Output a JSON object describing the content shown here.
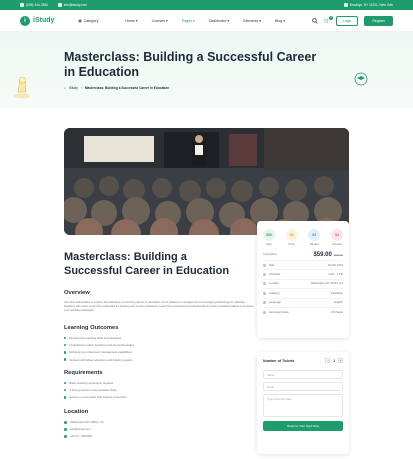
{
  "topbar": {
    "phone": "(505) 444-7880",
    "email": "info@istudy.com",
    "address": "Brooklyn, NY 11221, New York"
  },
  "nav": {
    "logo": "iStudy",
    "category": "Category",
    "menu": [
      {
        "label": "Home"
      },
      {
        "label": "Courses"
      },
      {
        "label": "Pages"
      },
      {
        "label": "Dashboard"
      },
      {
        "label": "Elements"
      },
      {
        "label": "Blog"
      }
    ],
    "login": "Login",
    "register": "Register",
    "cart_count": "0"
  },
  "hero": {
    "title": "Masterclass: Building a Successful Career in Education",
    "crumb_home": "iStudy",
    "crumb_current": "Masterclass: Building a Successful Career in Education"
  },
  "event": {
    "title": "Masterclass: Building a Successful Career in Education",
    "overview_heading": "Overview",
    "overview_text": "Join this masterclass to explore the pathways to a thriving career in education. From classroom management to leveraging technology for effective teaching, this event covers the essentials for aspiring and current educators. Learn from experienced professionals and gain practical insights to enhance your teaching strategies.",
    "outcomes_heading": "Learning Outcomes",
    "outcomes": [
      "Develop key teaching skills and strategies",
      "Understand modern teaching tools and technologies",
      "Enhance your classroom management capabilities",
      "Network with fellow educators and industry experts"
    ],
    "req_heading": "Requirements",
    "requirements": [
      "Basic teaching experience required",
      "A strong interest in the education field",
      "Access to a computer with internet connection"
    ],
    "location_heading": "Location",
    "location": [
      "Washington DC 20001, US",
      "info@istudy.com",
      "+00 23 - 4567890"
    ]
  },
  "countdown": [
    {
      "value": "200",
      "label": "Days",
      "color": "#1e9c6b",
      "bg": "#e3f5ec"
    },
    {
      "value": "03",
      "label": "Hours",
      "color": "#e39a1a",
      "bg": "#fdf2dd"
    },
    {
      "value": "02",
      "label": "Minutes",
      "color": "#2f86d6",
      "bg": "#e2eefa"
    },
    {
      "value": "04",
      "label": "Seconds",
      "color": "#d64a7c",
      "bg": "#fbe5ec"
    }
  ],
  "ticket": {
    "price_label": "Ticket Price",
    "price": "$59.00",
    "old_price": "$99.00"
  },
  "details": [
    {
      "key": "Date",
      "value": "20 Mar 2024"
    },
    {
      "key": "Schedule",
      "value": "3 AM - 7 PM"
    },
    {
      "key": "Location",
      "value": "Washington DC 20001, US"
    },
    {
      "key": "Category",
      "value": "Education"
    },
    {
      "key": "Language",
      "value": "English"
    },
    {
      "key": "Estimated Seats",
      "value": "150 Seats"
    }
  ],
  "form": {
    "tickets_label": "Number of Tickets",
    "quantity": "1",
    "name_placeholder": "Name",
    "email_placeholder": "Email",
    "comment_placeholder": "Type Comment Here",
    "submit": "Reserve Your Spot Now"
  }
}
